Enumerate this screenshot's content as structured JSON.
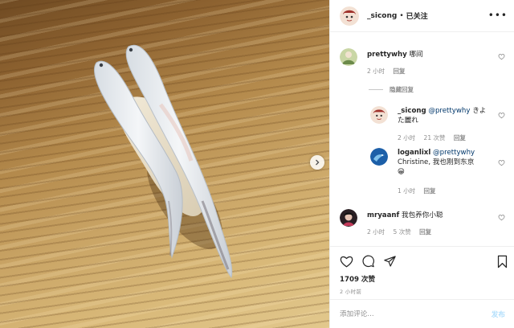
{
  "post": {
    "author": "_sicong",
    "separator": "•",
    "follow_status": "已关注",
    "more_icon": "more-horizontal-icon"
  },
  "comments": [
    {
      "username": "prettywhy",
      "text": "哪间",
      "time": "2 小时",
      "reply_label": "回复",
      "hide_replies_label": "隐藏回复",
      "replies": [
        {
          "username": "_sicong",
          "mention": "@prettywhy",
          "text": "きよた麗れ",
          "time": "2 小时",
          "likes": "21 次赞",
          "reply_label": "回复"
        },
        {
          "username": "loganlixl",
          "mention": "@prettywhy",
          "text": "Christine, 我也刚到东京",
          "emoji": "😀",
          "time": "1 小时",
          "reply_label": "回复"
        }
      ]
    },
    {
      "username": "mryaanf",
      "text": "我包养你小聪",
      "time": "2 小时",
      "likes": "5 次赞",
      "reply_label": "回复"
    }
  ],
  "engagement": {
    "likes": "1709 次赞",
    "time": "2 小时前"
  },
  "comment_box": {
    "placeholder": "添加评论...",
    "post_label": "发布"
  },
  "colors": {
    "link_blue": "#00376b",
    "post_disabled": "#b2dffc",
    "muted_text": "#8e8e8e"
  }
}
